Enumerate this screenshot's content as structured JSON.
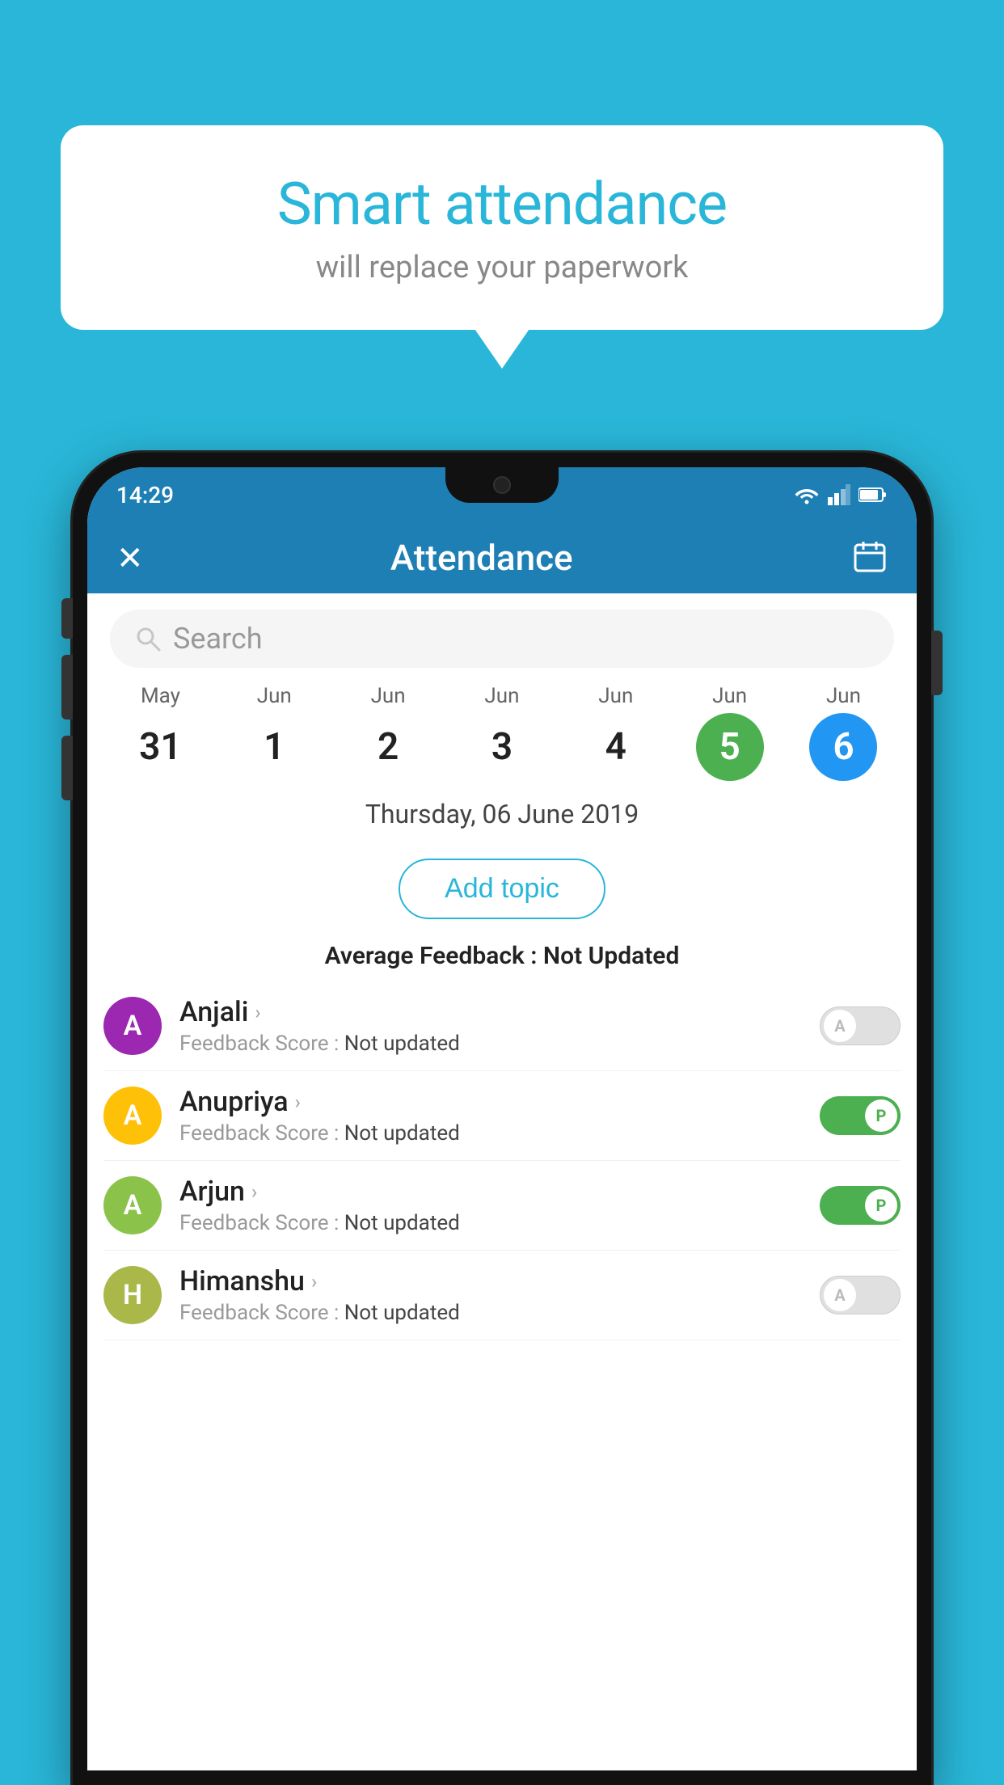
{
  "background_color": "#29b6d8",
  "bubble": {
    "title": "Smart attendance",
    "subtitle": "will replace your paperwork"
  },
  "status_bar": {
    "time": "14:29",
    "wifi_icon": "wifi",
    "signal_icon": "signal",
    "battery_icon": "battery"
  },
  "header": {
    "title": "Attendance",
    "close_label": "✕",
    "calendar_label": "📅"
  },
  "search": {
    "placeholder": "Search"
  },
  "dates": [
    {
      "month": "May",
      "day": "31",
      "style": "normal"
    },
    {
      "month": "Jun",
      "day": "1",
      "style": "normal"
    },
    {
      "month": "Jun",
      "day": "2",
      "style": "normal"
    },
    {
      "month": "Jun",
      "day": "3",
      "style": "normal"
    },
    {
      "month": "Jun",
      "day": "4",
      "style": "normal"
    },
    {
      "month": "Jun",
      "day": "5",
      "style": "green"
    },
    {
      "month": "Jun",
      "day": "6",
      "style": "blue"
    }
  ],
  "selected_date": "Thursday, 06 June 2019",
  "add_topic_label": "Add topic",
  "avg_feedback_label": "Average Feedback : ",
  "avg_feedback_value": "Not Updated",
  "students": [
    {
      "name": "Anjali",
      "avatar_letter": "A",
      "avatar_color": "#9c27b0",
      "feedback_label": "Feedback Score : ",
      "feedback_value": "Not updated",
      "toggle": "off",
      "toggle_letter": "A"
    },
    {
      "name": "Anupriya",
      "avatar_letter": "A",
      "avatar_color": "#ffc107",
      "feedback_label": "Feedback Score : ",
      "feedback_value": "Not updated",
      "toggle": "on",
      "toggle_letter": "P"
    },
    {
      "name": "Arjun",
      "avatar_letter": "A",
      "avatar_color": "#8bc34a",
      "feedback_label": "Feedback Score : ",
      "feedback_value": "Not updated",
      "toggle": "on",
      "toggle_letter": "P"
    },
    {
      "name": "Himanshu",
      "avatar_letter": "H",
      "avatar_color": "#aab84a",
      "feedback_label": "Feedback Score : ",
      "feedback_value": "Not updated",
      "toggle": "off",
      "toggle_letter": "A"
    }
  ]
}
